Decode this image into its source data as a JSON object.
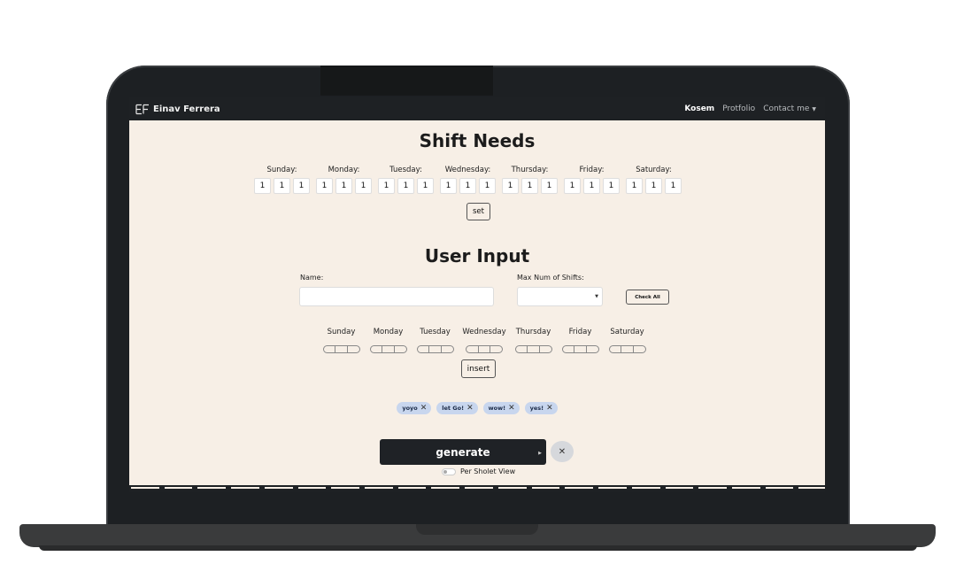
{
  "navbar": {
    "brand": "Einav Ferrera",
    "links": [
      {
        "label": "Kosem",
        "active": true
      },
      {
        "label": "Protfolio",
        "active": false
      },
      {
        "label": "Contact me",
        "active": false,
        "dropdown": true
      }
    ]
  },
  "shift_needs": {
    "title": "Shift Needs",
    "days": [
      {
        "label": "Sunday:",
        "values": [
          "1",
          "1",
          "1"
        ]
      },
      {
        "label": "Monday:",
        "values": [
          "1",
          "1",
          "1"
        ]
      },
      {
        "label": "Tuesday:",
        "values": [
          "1",
          "1",
          "1"
        ]
      },
      {
        "label": "Wednesday:",
        "values": [
          "1",
          "1",
          "1"
        ]
      },
      {
        "label": "Thursday:",
        "values": [
          "1",
          "1",
          "1"
        ]
      },
      {
        "label": "Friday:",
        "values": [
          "1",
          "1",
          "1"
        ]
      },
      {
        "label": "Saturday:",
        "values": [
          "1",
          "1",
          "1"
        ]
      }
    ],
    "set_label": "set"
  },
  "user_input": {
    "title": "User Input",
    "name_label": "Name:",
    "name_value": "",
    "max_shifts_label": "Max Num of Shifts:",
    "max_shifts_value": "",
    "check_all_label": "Check All",
    "week_days": [
      "Sunday",
      "Monday",
      "Tuesday",
      "Wednesday",
      "Thursday",
      "Friday",
      "Saturday"
    ],
    "insert_label": "insert"
  },
  "users": [
    "yoyo",
    "let Go!",
    "wow!",
    "yes!"
  ],
  "generate": {
    "label": "generate",
    "toggle_label": "Per Sholet View",
    "toggle_on": false
  },
  "icons": {
    "close": "close-icon",
    "dropdown": "chevron-down-icon"
  },
  "colors": {
    "navbar": "#1e2124",
    "background": "#f7efe6",
    "chip": "#c8d6ee",
    "primary_button": "#1f2226"
  }
}
